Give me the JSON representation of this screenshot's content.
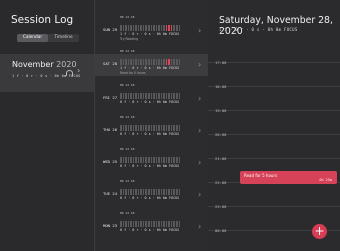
{
  "window": {
    "title": "Session Log",
    "colors": {
      "close": "#ff5f57",
      "minimize": "#febc2e",
      "zoom": "#28c840"
    }
  },
  "view_switch": {
    "options": [
      "Calendar",
      "Timeline"
    ],
    "selected": "Calendar"
  },
  "month": {
    "title": "November",
    "year": "2020",
    "stats": "1 f · 0 r · 0 s · 0h 0m FOCUS"
  },
  "days": [
    {
      "label": "SUN 29",
      "mini": "00  12  18",
      "stats": "1 f · 0 r · 0 s · 0h 0m FOCUS",
      "note": "Try Reading",
      "highlight": [
        6,
        7,
        8
      ]
    },
    {
      "label": "SAT 28",
      "mini": "00  12  18",
      "stats": "1 f · 0 r · 0 s · 0h 0m FOCUS",
      "note": "Read for 5 hours",
      "selected": true,
      "highlight": [
        6,
        7
      ]
    },
    {
      "label": "FRI 27",
      "mini": "00  12  18",
      "stats": "0 f · 0 r · 0 s · 0h 0m FOCUS",
      "note": ""
    },
    {
      "label": "THU 26",
      "mini": "00  12  18",
      "stats": "0 f · 0 r · 0 s · 0h 0m FOCUS",
      "note": ""
    },
    {
      "label": "WED 25",
      "mini": "00  12  18",
      "stats": "0 f · 0 r · 0 s · 0h 0m FOCUS",
      "note": ""
    },
    {
      "label": "TUE 24",
      "mini": "00  12  18",
      "stats": "0 f · 0 r · 0 s · 0h 0m FOCUS",
      "note": ""
    },
    {
      "label": "MON 23",
      "mini": "00  12  18",
      "stats": "0 f · 0 r · 0 s · 0h 0m FOCUS",
      "note": ""
    }
  ],
  "detail": {
    "date_title": "Saturday, November 28, 2020",
    "stats": "1 f · 0 r · 0 s · 0h 0m FOCUS",
    "times": [
      "17:00",
      "18:00",
      "19:00",
      "20:00",
      "21:00",
      "22:00",
      "23:00",
      "00:00"
    ],
    "event": {
      "title": "Read for 5 hours",
      "time": "0h 25m"
    }
  },
  "fab_label": "+",
  "accent": "#d64257"
}
